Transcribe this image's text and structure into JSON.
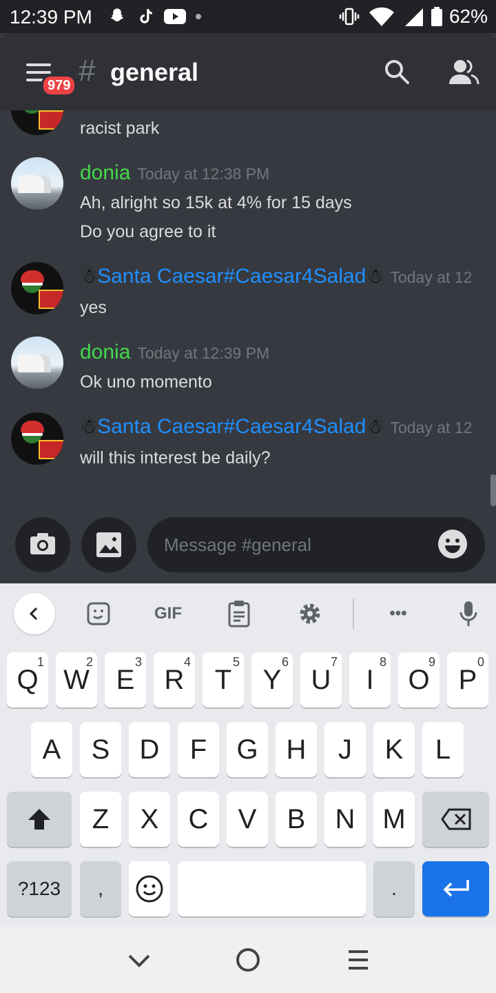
{
  "status_bar": {
    "time": "12:39 PM",
    "battery": "62%"
  },
  "header": {
    "channel_name": "general",
    "unread_badge": "979"
  },
  "messages": [
    {
      "author": "",
      "timestamp": "",
      "lines": [
        "racist park"
      ],
      "avatar": "santa-avatar"
    },
    {
      "author": "donia",
      "timestamp": "Today at 12:38 PM",
      "lines": [
        "Ah, alright so 15k at 4% for 15 days",
        "Do you agree to it"
      ],
      "avatar": "truck-avatar"
    },
    {
      "author": "Santa Caesar#Caesar4Salad",
      "timestamp": "Today at 12",
      "lines": [
        "yes"
      ],
      "avatar": "santa-avatar"
    },
    {
      "author": "donia",
      "timestamp": "Today at 12:39 PM",
      "lines": [
        "Ok uno momento"
      ],
      "avatar": "truck-avatar"
    },
    {
      "author": "Santa Caesar#Caesar4Salad",
      "timestamp": "Today at 12",
      "lines": [
        "will this interest be daily?"
      ],
      "avatar": "santa-avatar"
    }
  ],
  "composer": {
    "placeholder": "Message #general"
  },
  "keyboard": {
    "toolbar": {
      "gif_label": "GIF",
      "more_label": "•••"
    },
    "row1": [
      {
        "k": "Q",
        "n": "1"
      },
      {
        "k": "W",
        "n": "2"
      },
      {
        "k": "E",
        "n": "3"
      },
      {
        "k": "R",
        "n": "4"
      },
      {
        "k": "T",
        "n": "5"
      },
      {
        "k": "Y",
        "n": "6"
      },
      {
        "k": "U",
        "n": "7"
      },
      {
        "k": "I",
        "n": "8"
      },
      {
        "k": "O",
        "n": "9"
      },
      {
        "k": "P",
        "n": "0"
      }
    ],
    "row2": [
      "A",
      "S",
      "D",
      "F",
      "G",
      "H",
      "J",
      "K",
      "L"
    ],
    "row3": [
      "Z",
      "X",
      "C",
      "V",
      "B",
      "N",
      "M"
    ],
    "symbols_label": "?123",
    "comma": ",",
    "period": "."
  },
  "colors": {
    "bg": "#36393f",
    "appbar": "#2f3136",
    "green_name": "#43d94a",
    "blue_name": "#1f8fff",
    "accent": "#1a73e8",
    "badge": "#ed4245"
  }
}
